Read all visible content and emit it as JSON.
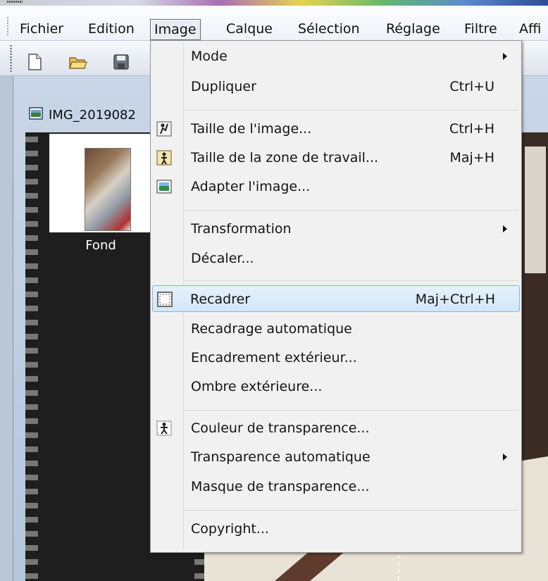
{
  "menubar": {
    "items": [
      {
        "label": "Fichier",
        "open": false
      },
      {
        "label": "Edition",
        "open": false
      },
      {
        "label": "Image",
        "open": true
      },
      {
        "label": "Calque",
        "open": false
      },
      {
        "label": "Sélection",
        "open": false
      },
      {
        "label": "Réglage",
        "open": false
      },
      {
        "label": "Filtre",
        "open": false
      },
      {
        "label": "Affi",
        "open": false
      }
    ]
  },
  "toolbar": {
    "icons": [
      "new-document-icon",
      "open-folder-icon",
      "save-icon"
    ]
  },
  "document": {
    "title": "IMG_2019082",
    "icon": "image-document-icon"
  },
  "layers": {
    "items": [
      {
        "name": "Fond"
      }
    ]
  },
  "image_menu": {
    "items": [
      {
        "type": "item",
        "label": "Mode",
        "shortcut": "",
        "submenu": true
      },
      {
        "type": "item",
        "label": "Dupliquer",
        "shortcut": "Ctrl+U",
        "submenu": false
      },
      {
        "type": "separator"
      },
      {
        "type": "item",
        "label": "Taille de l'image...",
        "shortcut": "Ctrl+H",
        "icon": "resize-image-icon"
      },
      {
        "type": "item",
        "label": "Taille de la zone de travail...",
        "shortcut": "Maj+H",
        "icon": "canvas-size-icon"
      },
      {
        "type": "item",
        "label": "Adapter l'image...",
        "shortcut": "",
        "icon": "fit-image-icon"
      },
      {
        "type": "separator"
      },
      {
        "type": "item",
        "label": "Transformation",
        "shortcut": "",
        "submenu": true
      },
      {
        "type": "item",
        "label": "Décaler...",
        "shortcut": ""
      },
      {
        "type": "separator"
      },
      {
        "type": "item",
        "label": "Recadrer",
        "shortcut": "Maj+Ctrl+H",
        "icon": "crop-icon",
        "highlighted": true
      },
      {
        "type": "item",
        "label": "Recadrage automatique",
        "shortcut": ""
      },
      {
        "type": "item",
        "label": "Encadrement extérieur...",
        "shortcut": ""
      },
      {
        "type": "item",
        "label": "Ombre extérieure...",
        "shortcut": ""
      },
      {
        "type": "separator"
      },
      {
        "type": "item",
        "label": "Couleur de transparence...",
        "shortcut": "",
        "icon": "transparency-color-icon"
      },
      {
        "type": "item",
        "label": "Transparence automatique",
        "shortcut": "",
        "submenu": true
      },
      {
        "type": "item",
        "label": "Masque de transparence...",
        "shortcut": ""
      },
      {
        "type": "separator"
      },
      {
        "type": "item",
        "label": "Copyright...",
        "shortcut": ""
      }
    ]
  },
  "colors": {
    "highlight_fill": "#d2e6f7",
    "highlight_border": "#86b4e0",
    "menu_bg": "#f1f1f1"
  }
}
